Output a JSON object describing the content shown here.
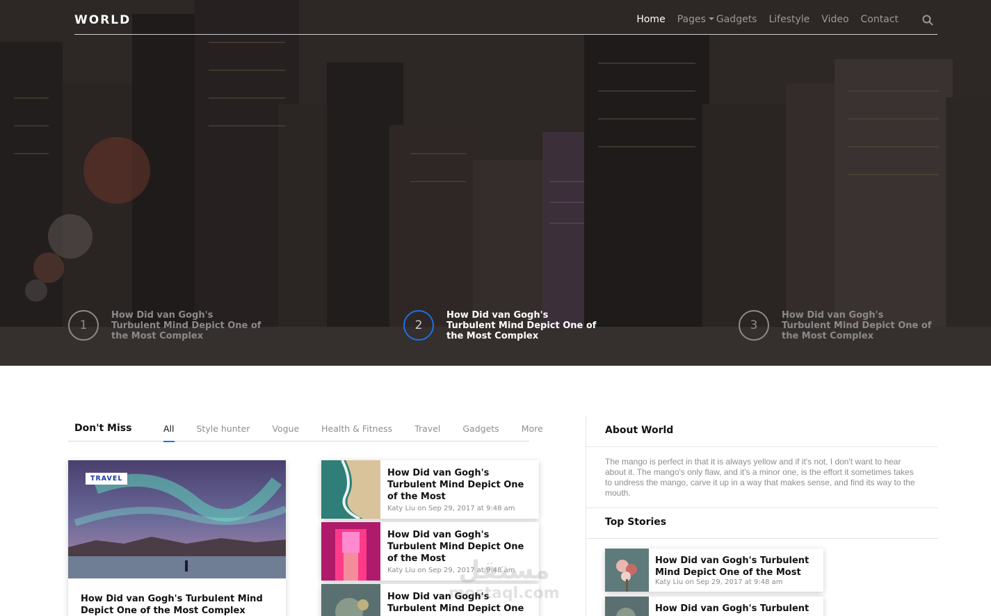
{
  "nav": {
    "logo": "WORLD",
    "items": [
      {
        "label": "Home",
        "active": true
      },
      {
        "label": "Pages",
        "dropdown": true
      },
      {
        "label": "Gadgets"
      },
      {
        "label": "Lifestyle"
      },
      {
        "label": "Video"
      },
      {
        "label": "Contact"
      }
    ],
    "search_icon": "search-icon"
  },
  "hero": {
    "slides": [
      {
        "number": "1",
        "title": "How Did van Gogh's Turbulent Mind Depict One of the Most Complex"
      },
      {
        "number": "2",
        "title": "How Did van Gogh's Turbulent Mind Depict One of the Most Complex",
        "active": true
      },
      {
        "number": "3",
        "title": "How Did van Gogh's Turbulent Mind Depict One of the Most Complex"
      }
    ]
  },
  "dont_miss": {
    "title": "Don't Miss",
    "tabs": [
      {
        "label": "All",
        "active": true
      },
      {
        "label": "Style hunter"
      },
      {
        "label": "Vogue"
      },
      {
        "label": "Health & Fitness"
      },
      {
        "label": "Travel"
      },
      {
        "label": "Gadgets"
      },
      {
        "label": "More"
      }
    ],
    "featured": {
      "badge": "TRAVEL",
      "title": "How Did van Gogh's Turbulent Mind Depict One of the Most Complex Concepts in"
    },
    "list": [
      {
        "title": "How Did van Gogh's Turbulent Mind Depict One of the Most",
        "meta": "Katy Liu on Sep 29, 2017 at 9:48 am"
      },
      {
        "title": "How Did van Gogh's Turbulent Mind Depict One of the Most",
        "meta": "Katy Liu on Sep 29, 2017 at 9:48 am"
      },
      {
        "title": "How Did van Gogh's Turbulent Mind Depict One of the Most",
        "meta": ""
      }
    ]
  },
  "sidebar": {
    "about_title": "About World",
    "about_text": "The mango is perfect in that it is always yellow and if it's not, I don't want to hear about it. The mango's only flaw, and it's a minor one, is the effort it sometimes takes to undress the mango, carve it up in a way that makes sense, and find its way to the mouth.",
    "top_title": "Top Stories",
    "top_stories": [
      {
        "title": "How Did van Gogh's Turbulent Mind Depict One of the Most",
        "meta": "Katy Liu on Sep 29, 2017 at 9:48 am"
      },
      {
        "title": "How Did van Gogh's Turbulent Mind",
        "meta": ""
      }
    ]
  },
  "watermark": {
    "line1": "مستقل",
    "line2": "mostaql.com"
  },
  "colors": {
    "accent": "#1a73e8",
    "badge_text": "#1f3aa8",
    "hero_bg": "#2e2827"
  }
}
